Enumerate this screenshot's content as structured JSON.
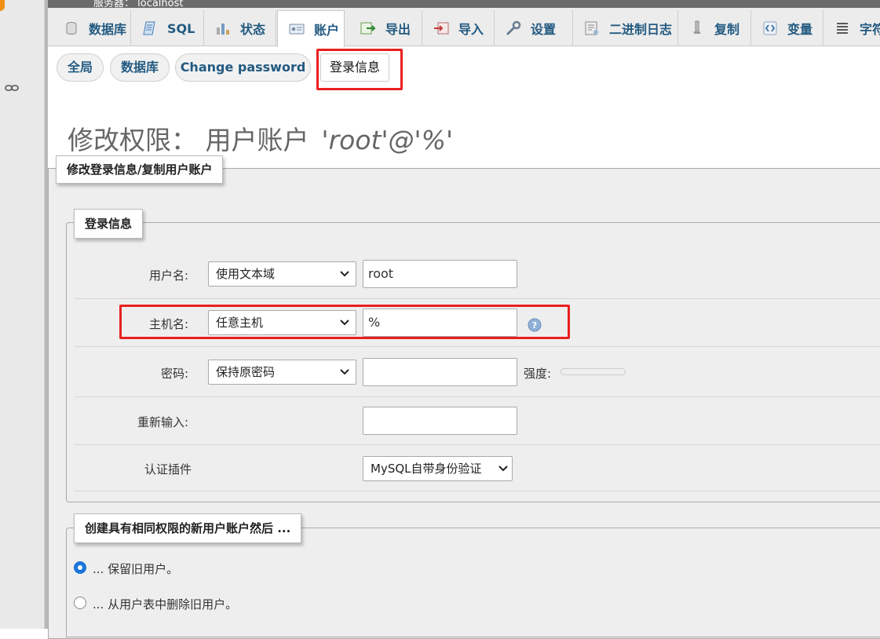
{
  "topbar": {
    "server_text": "服务器： localhost"
  },
  "tabs": [
    {
      "label": "数据库",
      "icon": "database-icon"
    },
    {
      "label": "SQL",
      "icon": "sql-icon"
    },
    {
      "label": "状态",
      "icon": "status-icon"
    },
    {
      "label": "账户",
      "icon": "accounts-icon",
      "active": true
    },
    {
      "label": "导出",
      "icon": "export-icon"
    },
    {
      "label": "导入",
      "icon": "import-icon"
    },
    {
      "label": "设置",
      "icon": "wrench-icon"
    },
    {
      "label": "二进制日志",
      "icon": "binlog-icon"
    },
    {
      "label": "复制",
      "icon": "replication-icon"
    },
    {
      "label": "变量",
      "icon": "variables-icon"
    },
    {
      "label": "字符",
      "icon": "charset-icon"
    }
  ],
  "subtabs": [
    {
      "label": "全局"
    },
    {
      "label": "数据库"
    },
    {
      "label": "Change password"
    },
    {
      "label": "登录信息",
      "active": true
    }
  ],
  "page_title": {
    "prefix": "修改权限：",
    "account_label": "用户账户",
    "account": "'root'@'%'"
  },
  "outer_legend": "修改登录信息/复制用户账户",
  "login_legend": "登录信息",
  "form": {
    "username": {
      "label": "用户名:",
      "select": "使用文本域",
      "value": "root"
    },
    "host": {
      "label": "主机名:",
      "select": "任意主机",
      "value": "%"
    },
    "password": {
      "label": "密码:",
      "select": "保持原密码",
      "value": "",
      "strength_label": "强度:"
    },
    "retype": {
      "label": "重新输入:",
      "value": ""
    },
    "auth_plugin": {
      "label": "认证插件",
      "select": "MySQL自带身份验证"
    }
  },
  "create_legend": "创建具有相同权限的新用户账户然后 ...",
  "options": [
    {
      "label": "... 保留旧用户。",
      "checked": true
    },
    {
      "label": "... 从用户表中删除旧用户。",
      "checked": false
    }
  ],
  "colors": {
    "highlight": "#e8201f",
    "link": "#235a81",
    "radio_checked": "#1b75d9"
  }
}
